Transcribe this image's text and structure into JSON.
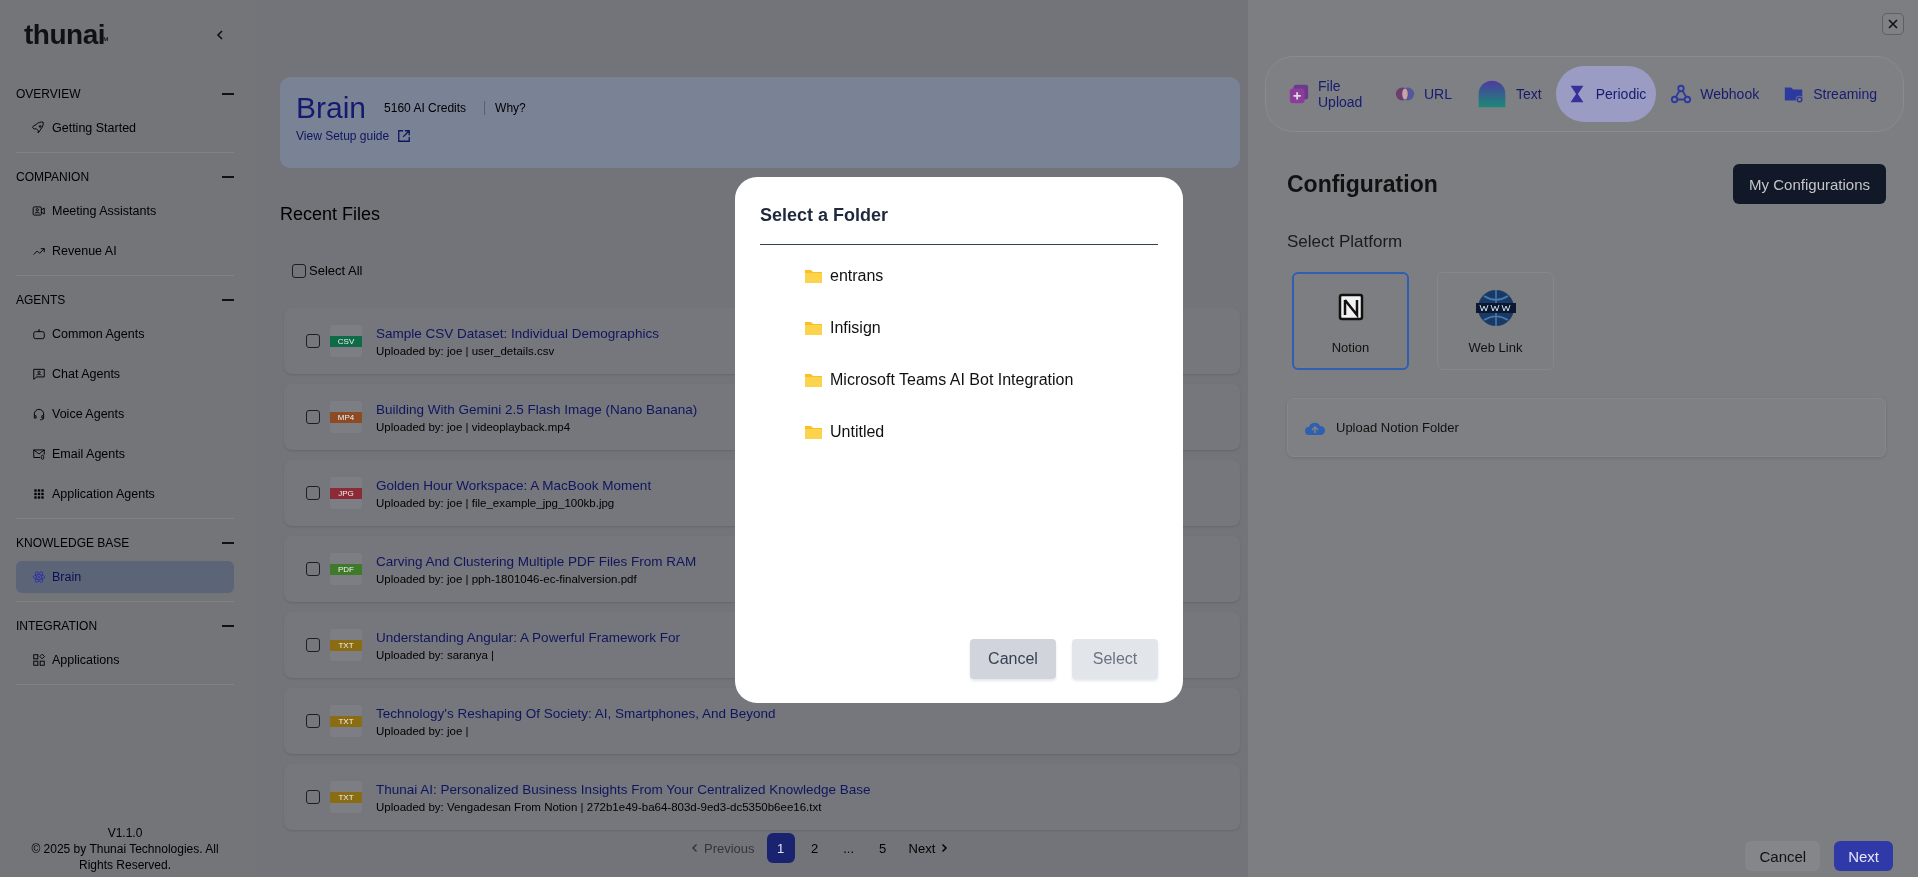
{
  "sidebar": {
    "logo": "thunai",
    "trademark": "™",
    "sections": [
      {
        "title": "OVERVIEW",
        "items": [
          {
            "label": "Getting Started",
            "selected": false
          }
        ]
      },
      {
        "title": "COMPANION",
        "items": [
          {
            "label": "Meeting Assistants",
            "selected": false
          },
          {
            "label": "Revenue AI",
            "selected": false
          }
        ]
      },
      {
        "title": "AGENTS",
        "items": [
          {
            "label": "Common Agents",
            "selected": false
          },
          {
            "label": "Chat Agents",
            "selected": false
          },
          {
            "label": "Voice Agents",
            "selected": false
          },
          {
            "label": "Email Agents",
            "selected": false
          },
          {
            "label": "Application Agents",
            "selected": false
          }
        ]
      },
      {
        "title": "KNOWLEDGE BASE",
        "items": [
          {
            "label": "Brain",
            "selected": true
          }
        ]
      },
      {
        "title": "INTEGRATION",
        "items": [
          {
            "label": "Applications",
            "selected": false
          }
        ]
      }
    ],
    "version": "V1.1.0",
    "copyright": "© 2025 by Thunai Technologies. All Rights Reserved."
  },
  "main": {
    "title": "Brain",
    "credits": "5160 AI Credits",
    "why": "Why?",
    "setup_guide": "View Setup guide",
    "recent_files_title": "Recent Files",
    "select_all": {
      "label": "Select All",
      "checked": false
    },
    "files": [
      {
        "title": "Sample CSV Dataset: Individual Demographics",
        "meta": "Uploaded by: joe | user_details.csv",
        "type_label": "CSV",
        "color": "#0f6a47",
        "checked": false
      },
      {
        "title": "Building With Gemini 2.5 Flash Image (Nano Banana)",
        "meta": "Uploaded by: joe | videoplayback.mp4",
        "type_label": "MP4",
        "color": "#8c4b22",
        "checked": false
      },
      {
        "title": "Golden Hour Workspace: A MacBook Moment",
        "meta": "Uploaded by: joe | file_example_jpg_100kb.jpg",
        "type_label": "JPG",
        "color": "#8c2a36",
        "checked": false
      },
      {
        "title": "Carving And Clustering Multiple PDF Files From RAM",
        "meta": "Uploaded by: joe | pph-1801046-ec-finalversion.pdf",
        "type_label": "PDF",
        "color": "#3f7a2b",
        "checked": false
      },
      {
        "title": "Understanding Angular: A Powerful Framework For",
        "meta": "Uploaded by: saranya |",
        "type_label": "TXT",
        "color": "#8a6c12",
        "checked": false
      },
      {
        "title": "Technology's Reshaping Of Society: AI, Smartphones, And Beyond",
        "meta": "Uploaded by: joe |",
        "type_label": "TXT",
        "color": "#8a6c12",
        "checked": false
      },
      {
        "title": "Thunai AI: Personalized Business Insights From Your Centralized Knowledge Base",
        "meta": "Uploaded by: Vengadesan From Notion | 272b1e49-ba64-803d-9ed3-dc5350b6ee16.txt",
        "type_label": "TXT",
        "color": "#8a6c12",
        "checked": false
      }
    ],
    "pagination": {
      "previous": {
        "label": "Previous",
        "disabled": true
      },
      "pages": [
        {
          "label": "1",
          "selected": true
        },
        {
          "label": "2",
          "selected": false
        },
        {
          "label": "...",
          "selected": false
        },
        {
          "label": "5",
          "selected": false
        }
      ],
      "next": {
        "label": "Next",
        "disabled": false
      }
    }
  },
  "drawer": {
    "tabs": [
      {
        "label": "File Upload",
        "selected": false
      },
      {
        "label": "URL",
        "selected": false
      },
      {
        "label": "Text",
        "selected": false
      },
      {
        "label": "Periodic",
        "selected": true
      },
      {
        "label": "Webhook",
        "selected": false
      },
      {
        "label": "Streaming",
        "selected": false
      }
    ],
    "title": "Configuration",
    "my_configurations": "My Configurations",
    "select_platform": "Select Platform",
    "platforms": [
      {
        "label": "Notion",
        "selected": true
      },
      {
        "label": "Web Link",
        "selected": false
      }
    ],
    "upload_folder": "Upload Notion Folder",
    "cancel": "Cancel",
    "next": "Next"
  },
  "dialog": {
    "title": "Select a Folder",
    "folders": [
      {
        "label": "entrans"
      },
      {
        "label": "Infisign"
      },
      {
        "label": "Microsoft Teams AI Bot Integration"
      },
      {
        "label": "Untitled"
      }
    ],
    "cancel": {
      "label": "Cancel",
      "disabled": false
    },
    "select": {
      "label": "Select",
      "disabled": true
    }
  }
}
